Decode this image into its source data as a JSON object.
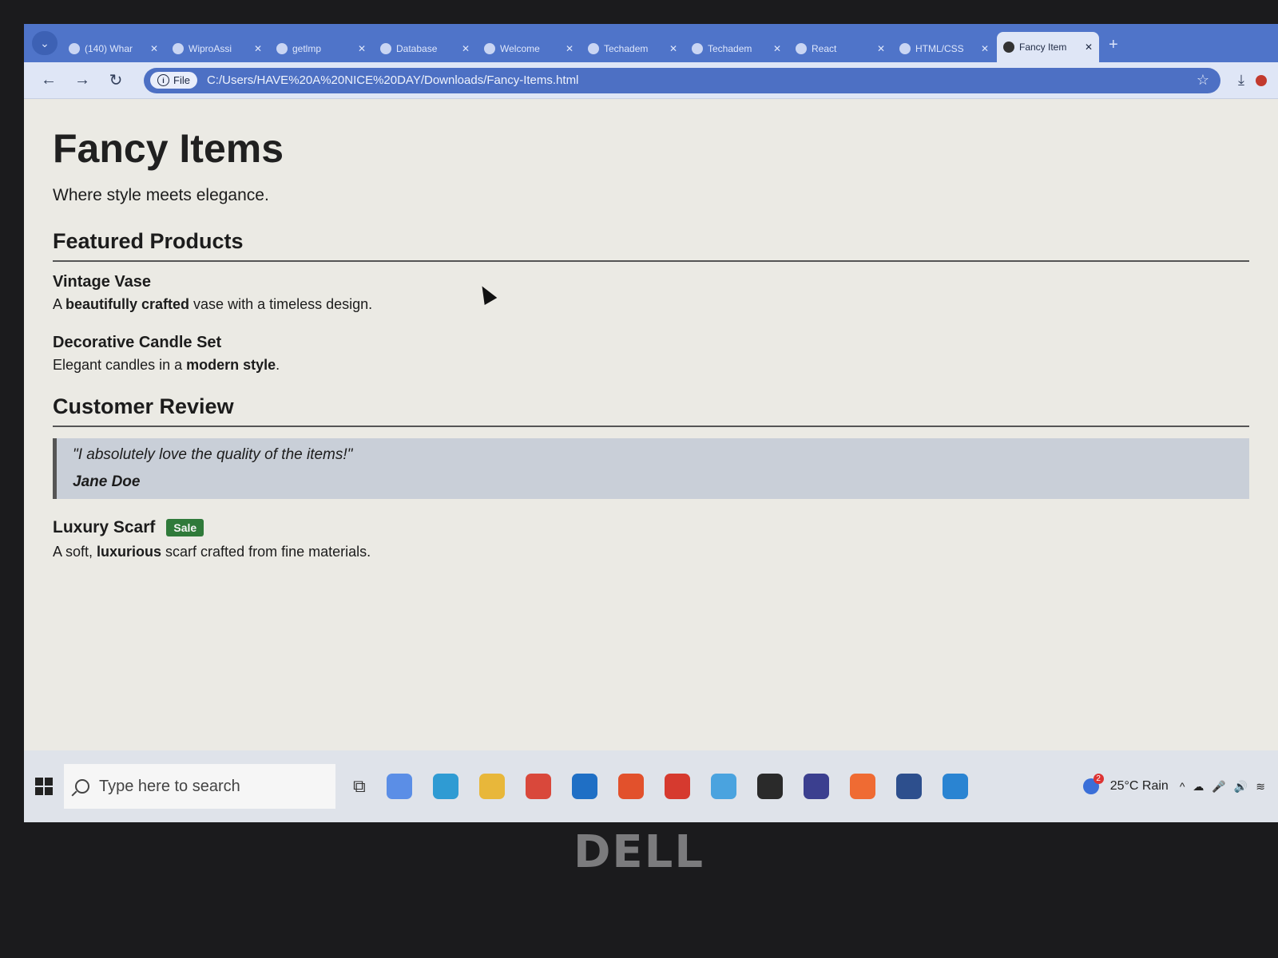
{
  "browser": {
    "tabs": [
      {
        "title": "(140) Whar"
      },
      {
        "title": "WiproAssi"
      },
      {
        "title": "getlmp"
      },
      {
        "title": "Database"
      },
      {
        "title": "Welcome"
      },
      {
        "title": "Techadem"
      },
      {
        "title": "Techadem"
      },
      {
        "title": "React"
      },
      {
        "title": "HTML/CSS"
      },
      {
        "title": "Fancy Item",
        "active": true
      }
    ],
    "close_glyph": "✕",
    "new_tab_glyph": "+",
    "address": {
      "chip_label": "File",
      "url": "C:/Users/HAVE%20A%20NICE%20DAY/Downloads/Fancy-Items.html"
    }
  },
  "page": {
    "title": "Fancy Items",
    "tagline": "Where style meets elegance.",
    "featured": {
      "heading": "Featured Products",
      "products": [
        {
          "name": "Vintage Vase",
          "desc_pre": "A ",
          "desc_bold": "beautifully crafted",
          "desc_post": " vase with a timeless design."
        },
        {
          "name": "Decorative Candle Set",
          "desc_pre": "Elegant candles in a ",
          "desc_bold": "modern style",
          "desc_post": "."
        }
      ]
    },
    "review": {
      "heading": "Customer Review",
      "quote": "\"I absolutely love the quality of the items!\"",
      "author": "Jane Doe"
    },
    "sale_item": {
      "name": "Luxury Scarf",
      "badge": "Sale",
      "desc_pre": "A soft, ",
      "desc_bold": "luxurious",
      "desc_post": " scarf crafted from fine materials."
    }
  },
  "taskbar": {
    "search_placeholder": "Type here to search",
    "weather": {
      "text": "25°C  Rain",
      "badge": "2"
    },
    "apps": [
      {
        "name": "copilot-icon",
        "color": "#5b8ee6"
      },
      {
        "name": "edge-icon",
        "color": "#2f9bd3"
      },
      {
        "name": "file-explorer-icon",
        "color": "#e8b73a"
      },
      {
        "name": "chrome-icon",
        "color": "#d9483b"
      },
      {
        "name": "outlook-icon",
        "color": "#1f6fc5"
      },
      {
        "name": "brave-icon",
        "color": "#e2512c"
      },
      {
        "name": "opera-icon",
        "color": "#d63a2f"
      },
      {
        "name": "notepad-icon",
        "color": "#4aa3df"
      },
      {
        "name": "terminal-icon",
        "color": "#2a2a2a"
      },
      {
        "name": "eclipse-icon",
        "color": "#3b3f8f"
      },
      {
        "name": "postman-icon",
        "color": "#ef6b33"
      },
      {
        "name": "snipping-tool-icon",
        "color": "#2d4f8d"
      },
      {
        "name": "vscode-icon",
        "color": "#2a84d2"
      }
    ]
  },
  "device": {
    "brand": "DELL"
  }
}
